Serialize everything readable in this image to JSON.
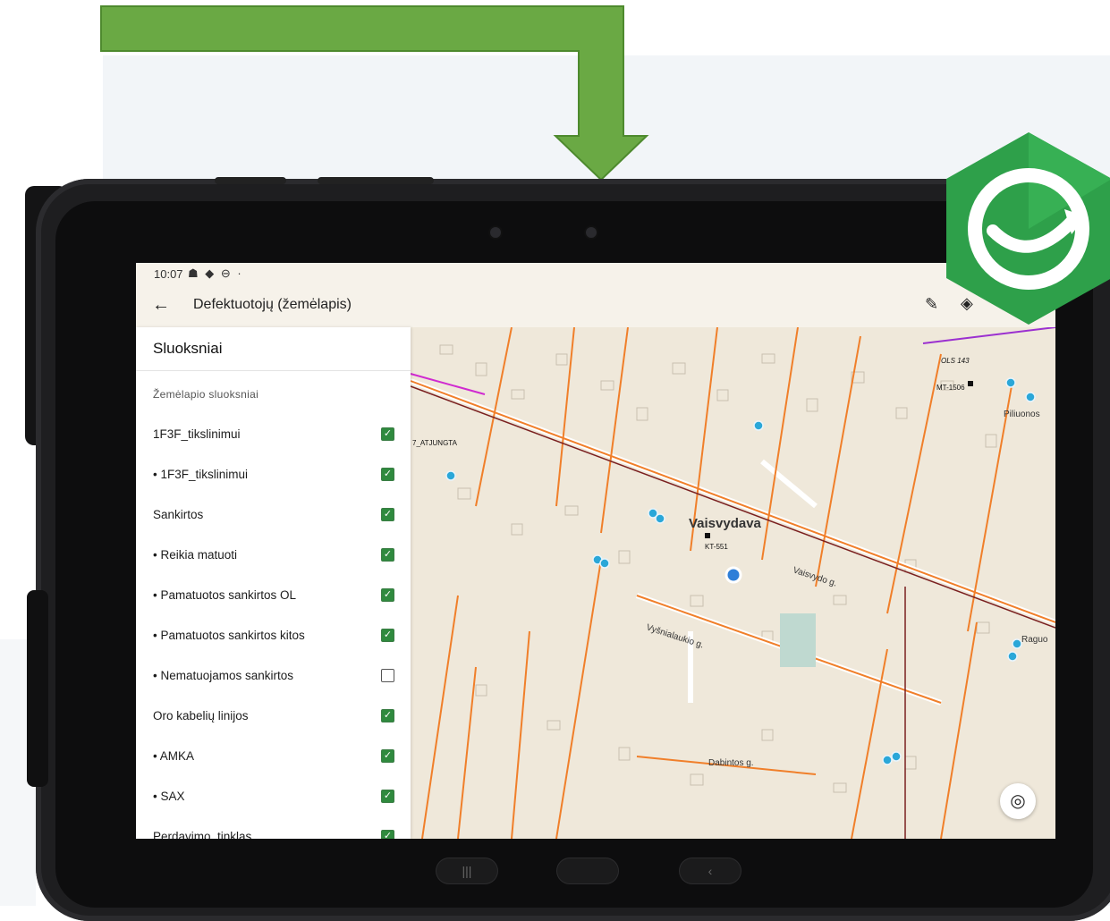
{
  "statusbar": {
    "time": "10:07",
    "icons": "☗ ◆ ⊖ ·"
  },
  "appbar": {
    "title": "Defektuotojų (žemėlapis)"
  },
  "drawer": {
    "title": "Sluoksniai",
    "section": "Žemėlapio sluoksniai",
    "items": [
      {
        "label": "1F3F_tikslinimui",
        "checked": true
      },
      {
        "label": "• 1F3F_tikslinimui",
        "checked": true
      },
      {
        "label": "Sankirtos",
        "checked": true
      },
      {
        "label": "• Reikia matuoti",
        "checked": true
      },
      {
        "label": "• Pamatuotos sankirtos OL",
        "checked": true
      },
      {
        "label": "• Pamatuotos sankirtos kitos",
        "checked": true
      },
      {
        "label": "• Nematuojamos sankirtos",
        "checked": false
      },
      {
        "label": "Oro kabelių linijos",
        "checked": true
      },
      {
        "label": "• AMKA",
        "checked": true
      },
      {
        "label": "• SAX",
        "checked": true
      },
      {
        "label": "Perdavimo_tinklas",
        "checked": true
      }
    ]
  },
  "map": {
    "street_main": "Vaisvydava",
    "street_2": "Vyšnialaukio g.",
    "street_3": "Dabintos g.",
    "street_4": "Vaisvydo g.",
    "street_5": "Piliuonos",
    "street_6": "Raguo",
    "label_kt": "KT-551",
    "label_ols": "OLS 143",
    "label_mt": "MT-1506",
    "label_jungta": "7_ATJUNGTA"
  },
  "colors": {
    "arrow": "#6aa944",
    "logo": "#2ea04a",
    "road_line": "#f07f2a"
  }
}
